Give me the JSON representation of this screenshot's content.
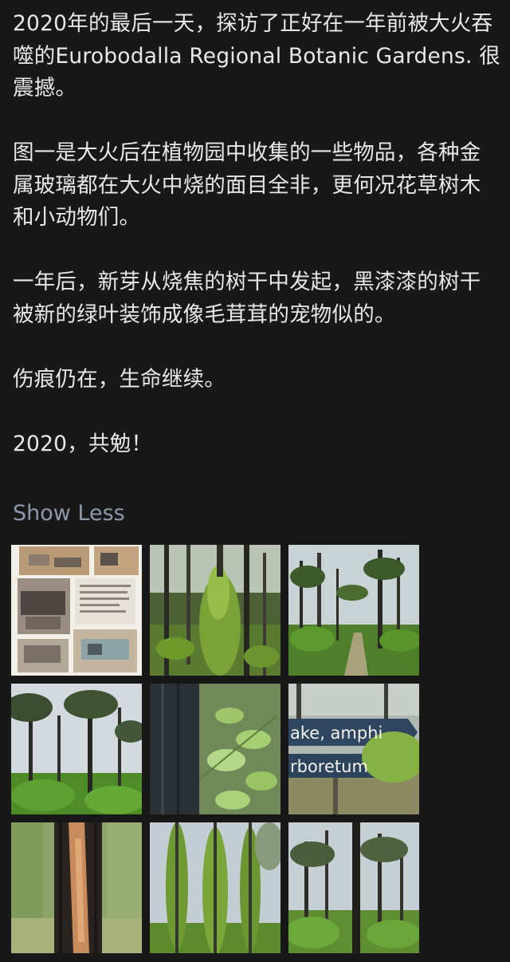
{
  "post": {
    "paragraphs": [
      "2020年的最后一天，探访了正好在一年前被大火吞噬的Eurobodalla Regional Botanic Gardens. 很震撼。",
      "图一是大火后在植物园中收集的一些物品，各种金属玻璃都在大火中烧的面目全非，更何况花草树木和小动物们。",
      "一年后，新芽从烧焦的树干中发起，黑漆漆的树干被新的绿叶装饰成像毛茸茸的宠物似的。",
      "伤痕仍在，生命继续。",
      "2020，共勉！"
    ],
    "show_less": "Show Less"
  },
  "photos": [
    {
      "name": "photo-1",
      "subject": "burnt objects collection display"
    },
    {
      "name": "photo-2",
      "subject": "fuzzy green shoots on trunk"
    },
    {
      "name": "photo-3",
      "subject": "forest path with green undergrowth"
    },
    {
      "name": "photo-4",
      "subject": "burnt forest under grey sky"
    },
    {
      "name": "photo-5",
      "subject": "charred trunk with new leaves"
    },
    {
      "name": "photo-6",
      "subject": "garden signs"
    },
    {
      "name": "photo-7",
      "subject": "split charred tree trunk"
    },
    {
      "name": "photo-8",
      "subject": "trunks covered in green shoots"
    },
    {
      "name": "photo-9",
      "subject": "blackened trunks in regrowth"
    }
  ],
  "signs": {
    "sign_1": "ake, amphi",
    "sign_2": "rboretum"
  },
  "colors": {
    "background": "#181818",
    "text": "#e8e8e8",
    "link": "#8d98ab"
  }
}
